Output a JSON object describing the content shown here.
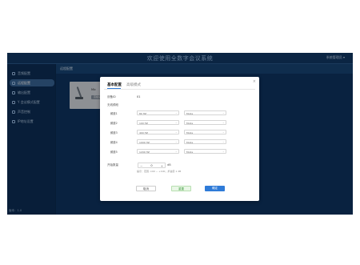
{
  "app": {
    "title": "欢迎使用全数字会议系统",
    "user_menu": "系统管理员 ▾",
    "version": "版本：1.0"
  },
  "sidebar": {
    "items": [
      {
        "label": "音频配置",
        "icon": "monitor-icon",
        "active": false
      },
      {
        "label": "远程配置",
        "icon": "wifi-icon",
        "active": true
      },
      {
        "label": "输出配置",
        "icon": "chart-icon",
        "active": false
      },
      {
        "label": "Y 会议模式配置",
        "icon": "people-icon",
        "active": false
      },
      {
        "label": "声音控制",
        "icon": "speaker-icon",
        "active": false
      },
      {
        "label": "IP地址设置",
        "icon": "network-icon",
        "active": false
      }
    ]
  },
  "main": {
    "breadcrumb": "远程配置",
    "device_card": {
      "name": "Mic",
      "button": "高级设置"
    }
  },
  "dialog": {
    "close": "×",
    "tabs": {
      "basic": "基本配置",
      "advanced": "高级模式"
    },
    "field1_label": "设备ID",
    "field1_value": "01",
    "section_label": "无线频段",
    "rows": [
      {
        "label": "频道1",
        "freq": "80 HZ",
        "mode": "Mode"
      },
      {
        "label": "频道2",
        "freq": "100 HZ",
        "mode": "Mode"
      },
      {
        "label": "频道3",
        "freq": "400 HZ",
        "mode": "Mode"
      },
      {
        "label": "频道4",
        "freq": "1000 HZ",
        "mode": "Mode"
      },
      {
        "label": "频道5",
        "freq": "1200 HZ",
        "mode": "Mode"
      }
    ],
    "stepper": {
      "label": "开始数量",
      "value": "0",
      "unit": "dB"
    },
    "hint": "提示：范围 -100 ~ +100，步进值 1 dB",
    "buttons": {
      "cancel": "取消",
      "reset": "重置",
      "save": "确定"
    }
  },
  "colors": {
    "app_bg": "#0b2b52",
    "sidebar_active": "#3a679a",
    "accent": "#2f7bd8",
    "reset_green": "#3a9a3a"
  }
}
